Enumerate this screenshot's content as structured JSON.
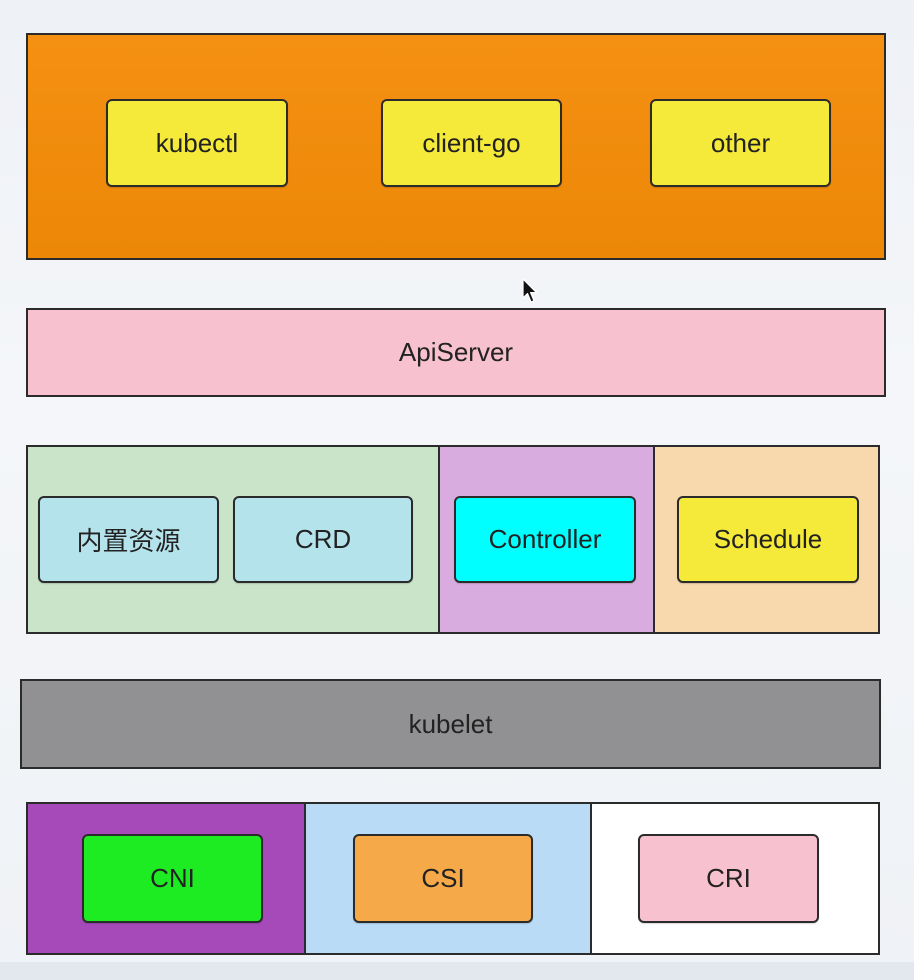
{
  "clients": {
    "kubectl": "kubectl",
    "client_go": "client-go",
    "other": "other"
  },
  "apiserver": "ApiServer",
  "resources": {
    "builtin": "内置资源",
    "crd": "CRD",
    "controller": "Controller",
    "schedule": "Schedule"
  },
  "kubelet": "kubelet",
  "plugins": {
    "cni": "CNI",
    "csi": "CSI",
    "cri": "CRI"
  },
  "colors": {
    "client_layer": "#f08c0c",
    "client_box": "#f5e93a",
    "apiserver": "#f7c1cf",
    "resource_panel": "#c9e4c9",
    "builtin_box": "#b5e3ec",
    "controller_panel": "#d9acdf",
    "controller_box": "#00ffff",
    "schedule_panel": "#f8d8ad",
    "schedule_box": "#f5e93a",
    "kubelet": "#919193",
    "cni_panel": "#a54ab8",
    "cni_box": "#1eec22",
    "csi_panel": "#b9dbf6",
    "csi_box": "#f5a949",
    "cri_panel": "#ffffff",
    "cri_box": "#f7c1cf"
  }
}
